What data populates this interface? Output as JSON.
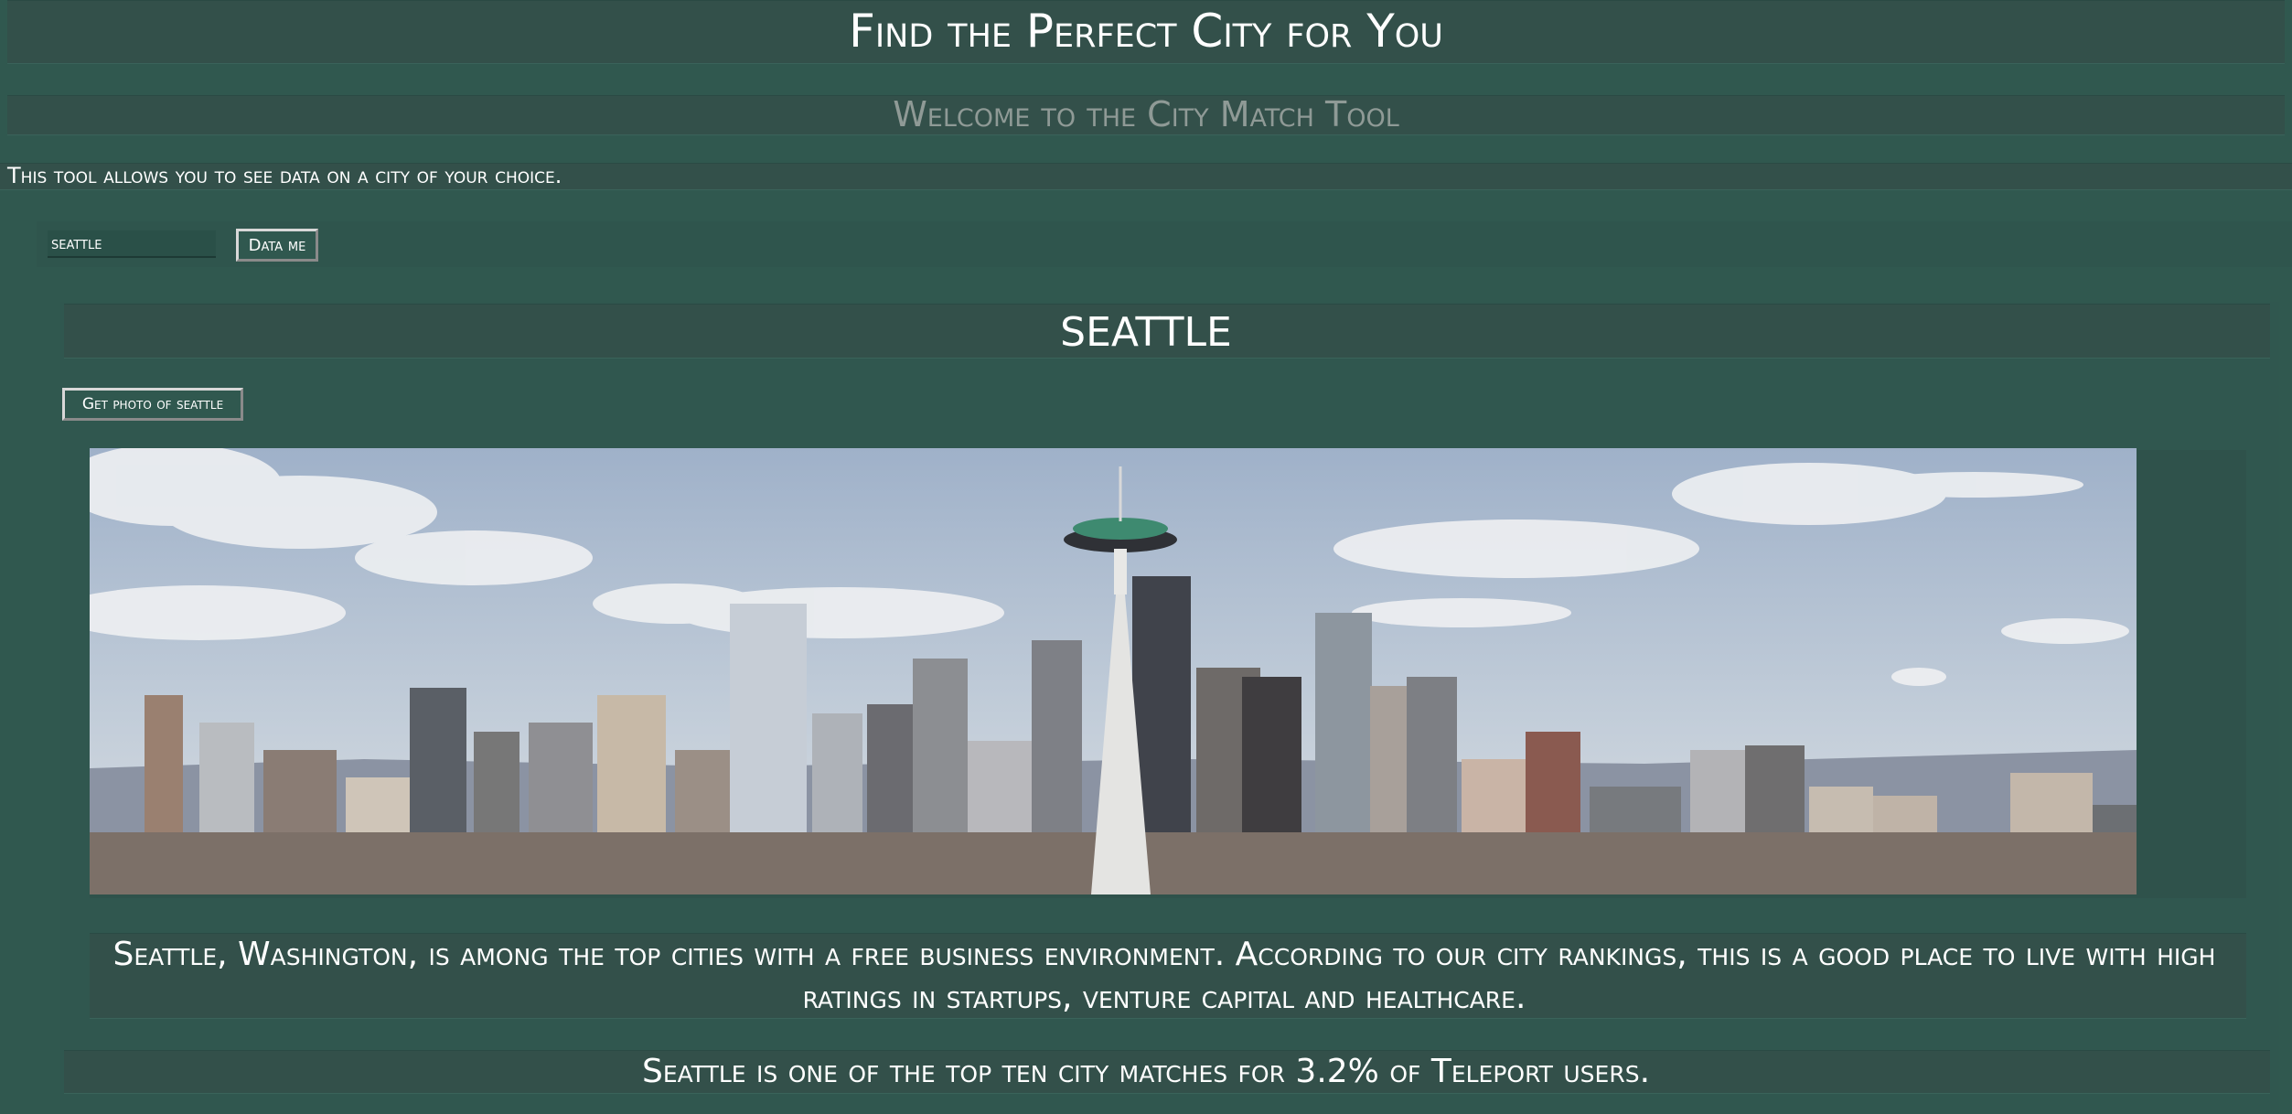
{
  "header": {
    "title": "Find the Perfect City for You",
    "welcome": "Welcome to the City Match Tool",
    "intro": "This tool allows you to see data on a city of your choice."
  },
  "search": {
    "value": "seattle",
    "button_label": "Data me"
  },
  "result": {
    "city_name": "SEATTLE",
    "photo_button_label": "Get photo of seattle",
    "photo_alt": "seattle-skyline-photo",
    "summary": "Seattle, Washington, is among the top cities with a free business environment. According to our city rankings, this is a good place to live with high ratings in startups, venture capital and healthcare.",
    "match": "Seattle is one of the top ten city matches for 3.2% of Teleport users."
  },
  "colors": {
    "background": "#30584f",
    "band": "#33504a",
    "text": "#ffffff",
    "muted": "#8f9a96"
  }
}
